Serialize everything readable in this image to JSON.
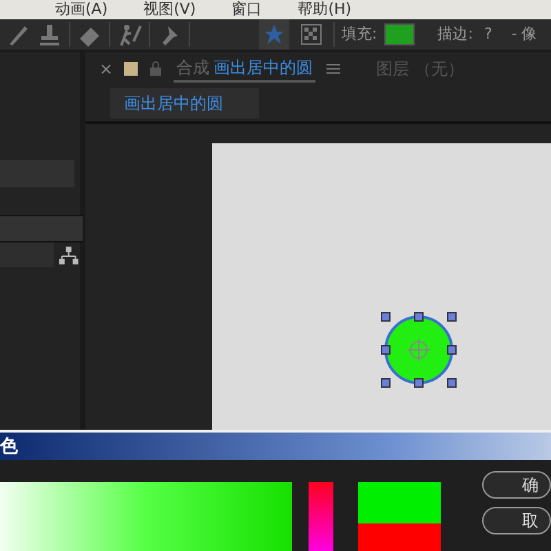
{
  "menu": [
    {
      "label": "动画(A)"
    },
    {
      "label": "视图(V)"
    },
    {
      "label": "窗口"
    },
    {
      "label": "帮助(H)"
    }
  ],
  "toolbar": {
    "tools": [
      {
        "kind": "brush"
      },
      {
        "kind": "stamp"
      },
      {
        "kind": "eraser"
      },
      {
        "kind": "roto"
      },
      {
        "kind": "pin"
      }
    ],
    "shape_modes": [
      {
        "kind": "star",
        "selected": true
      },
      {
        "kind": "checker",
        "selected": false
      }
    ],
    "fill_label": "填充:",
    "stroke_label": "描边:",
    "stroke_value": "?",
    "extra": "- 像"
  },
  "comp_panel": {
    "close": "×",
    "prefix": "合成",
    "name": "画出居中的圆",
    "layer_label": "图层 （无）",
    "subtab": {
      "label": "画出居中的圆",
      "selected": true
    }
  },
  "dialog": {
    "title": "色",
    "buttons": [
      {
        "label": "确"
      },
      {
        "label": "取"
      }
    ]
  }
}
